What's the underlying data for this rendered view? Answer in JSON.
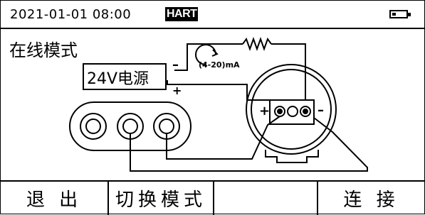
{
  "status": {
    "datetime": "2021-01-01  08:00",
    "protocol_badge": "HART",
    "battery_icon": "battery-low-icon",
    "battery_level": 0.25
  },
  "mode": {
    "title": "在线模式"
  },
  "diagram": {
    "source_label": "24V电源",
    "source_minus": "–",
    "source_plus": "+",
    "current_label": "(4-20)mA",
    "terminal_plus": "+",
    "terminal_minus": "–"
  },
  "menu": {
    "items": [
      {
        "label": "退 出"
      },
      {
        "label": "切换模式"
      },
      {
        "label": ""
      },
      {
        "label": "连 接"
      }
    ]
  }
}
